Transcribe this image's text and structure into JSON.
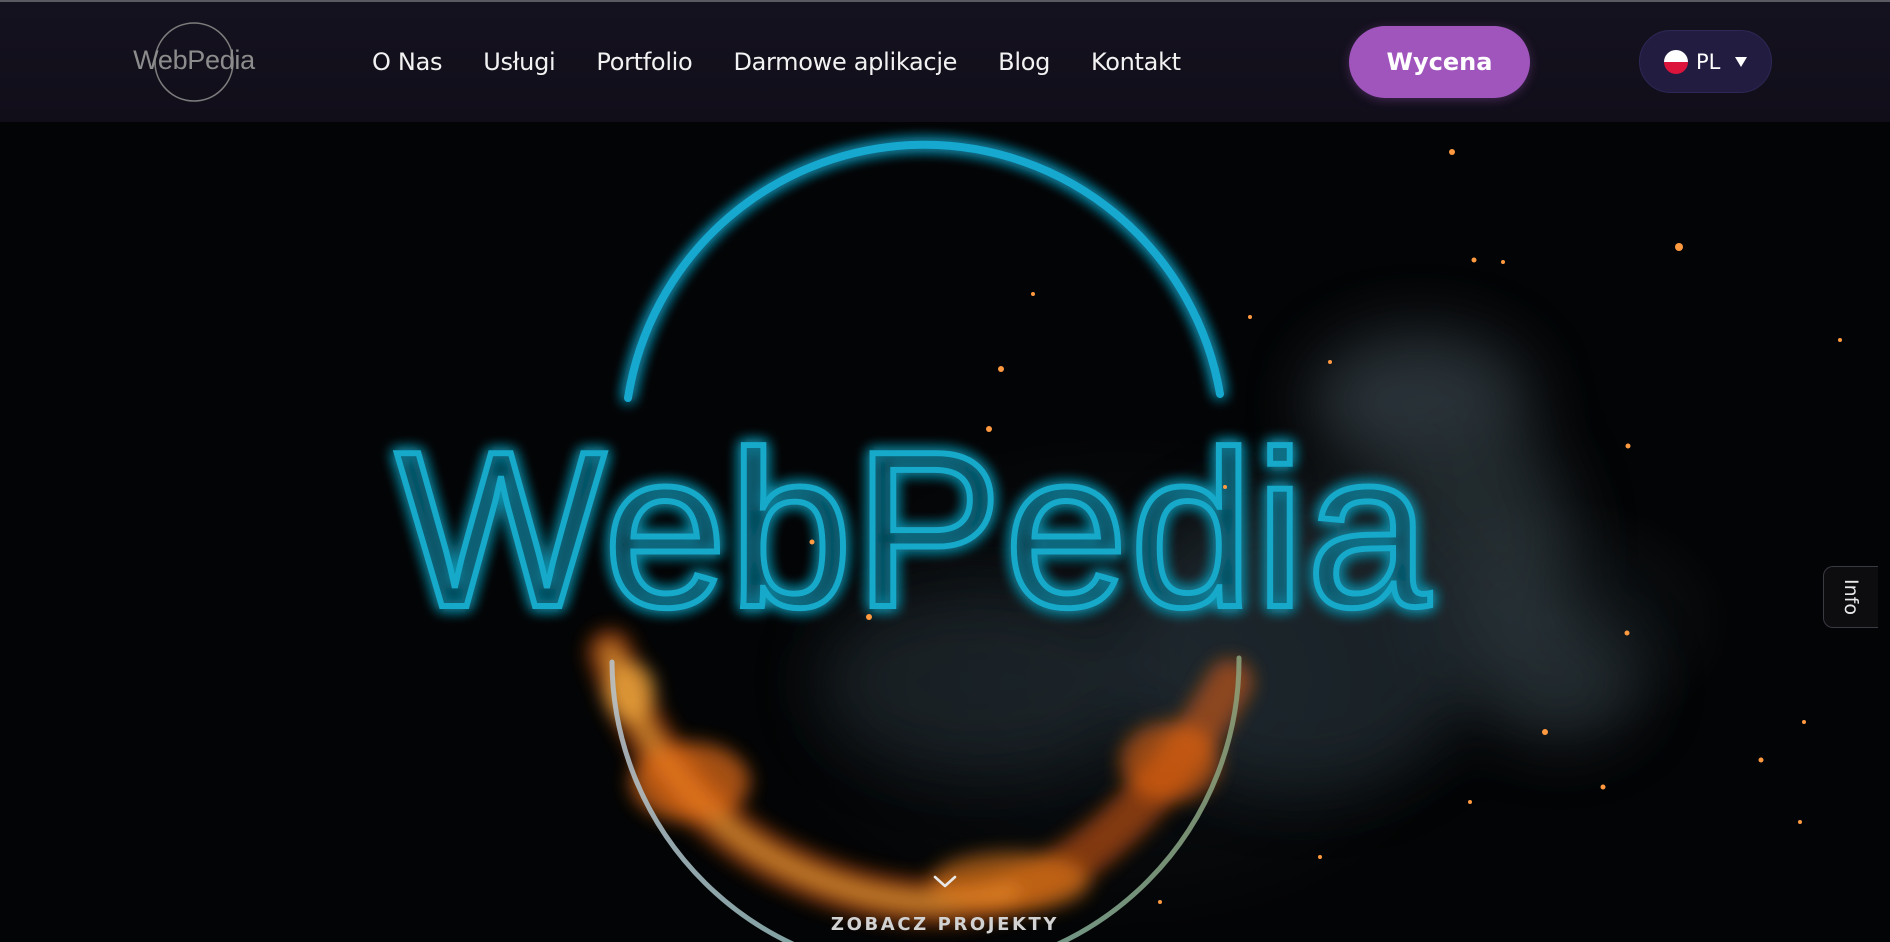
{
  "header": {
    "logo_text": "WebPedia",
    "nav_items": [
      {
        "label": "O Nas"
      },
      {
        "label": "Usługi"
      },
      {
        "label": "Portfolio"
      },
      {
        "label": "Darmowe aplikacje"
      },
      {
        "label": "Blog"
      },
      {
        "label": "Kontakt"
      }
    ],
    "cta_label": "Wycena",
    "language": {
      "code": "PL",
      "flag_icon": "poland-flag-icon"
    }
  },
  "hero": {
    "brand_text": "WebPedia",
    "scroll_label": "ZOBACZ PROJEKTY",
    "scroll_icon": "chevron-down-icon"
  },
  "side_tab": {
    "label": "Info"
  },
  "colors": {
    "nav_background": "#15121f",
    "accent_purple": "#a055bd",
    "language_pill": "#211c40",
    "neon_blue": "#14a5c8",
    "fire_orange": "#ff7a18"
  }
}
